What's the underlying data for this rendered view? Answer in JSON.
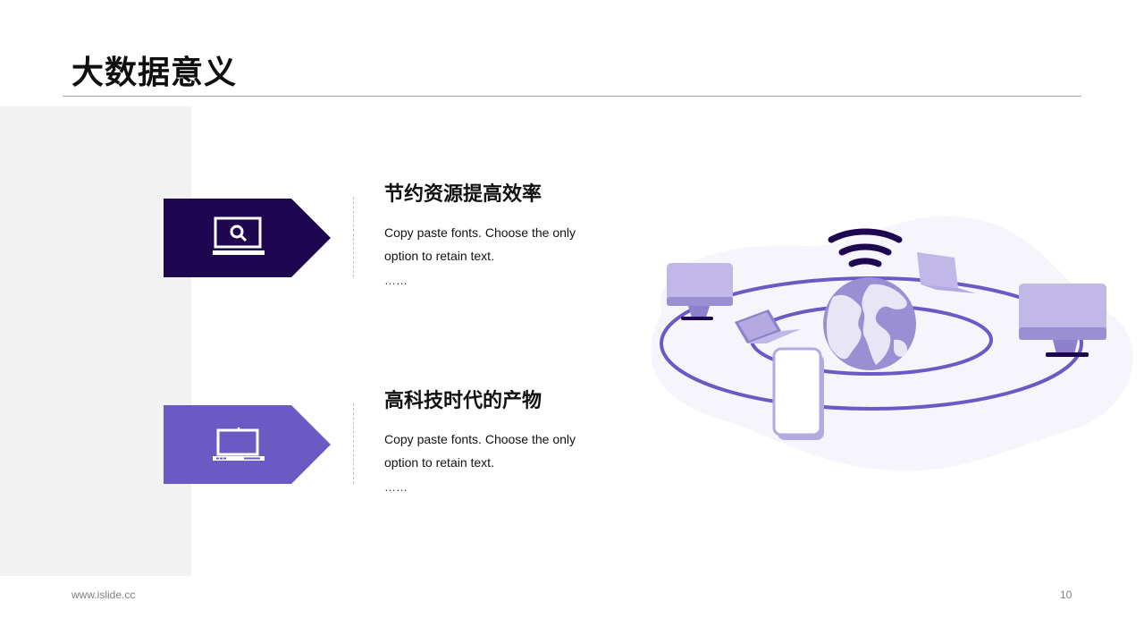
{
  "slide": {
    "title": "大数据意义",
    "items": [
      {
        "title": "节约资源提高效率",
        "desc": "Copy paste fonts. Choose the only option to retain text.",
        "more": "……",
        "icon": "monitor-search-icon",
        "color": "#1f0650"
      },
      {
        "title": "高科技时代的产物",
        "desc": "Copy paste fonts. Choose the only option to retain text.",
        "more": "……",
        "icon": "laptop-icon",
        "color": "#6b5ac4"
      }
    ],
    "illustration_icons": [
      "wifi-icon",
      "globe-icon",
      "monitor-icon",
      "laptop-icon",
      "smartphone-icon"
    ],
    "colors": {
      "dark_purple": "#1f0650",
      "purple": "#6b5ac4",
      "light_purple": "#c2b8e8",
      "panel_gray": "#f2f2f2"
    }
  },
  "footer": {
    "url": "www.islide.cc",
    "page": "10"
  }
}
